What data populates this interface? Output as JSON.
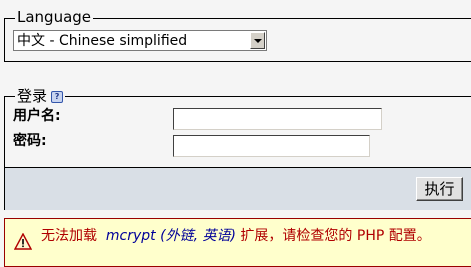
{
  "language": {
    "legend": "Language",
    "selected": "中文 - Chinese simplified"
  },
  "login": {
    "legend": "登录",
    "help_glyph": "?",
    "username_label": "用户名:",
    "password_label": "密码:",
    "username_value": "",
    "password_value": "",
    "submit_label": "执行"
  },
  "error": {
    "before": "无法加载",
    "module": "mcrypt",
    "paren_open": "(",
    "link1": "外链",
    "comma": ",",
    "link2": "英语",
    "paren_close": ")",
    "after": "扩展，请检查您的 PHP 配置。"
  },
  "colors": {
    "error_text": "#b00000",
    "error_bg": "#ffffcc",
    "footer_bg": "#d9dfe6"
  }
}
